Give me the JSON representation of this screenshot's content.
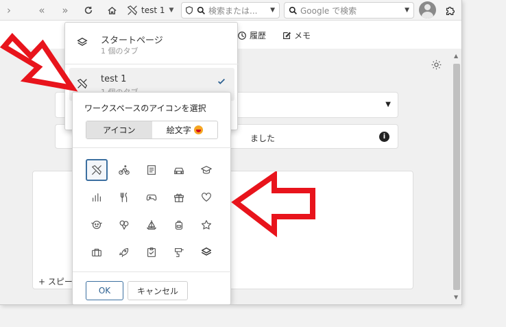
{
  "toolbar": {
    "workspace_name": "test 1",
    "url_placeholder": "検索または...",
    "search_placeholder": "Google で検索"
  },
  "bookmarks": {
    "history": "履歴",
    "memo": "メモ"
  },
  "workspace_menu": {
    "items": [
      {
        "name": "スタートページ",
        "count": "1 個のタブ"
      },
      {
        "name": "test 1",
        "count": "1 個のタブ",
        "active": true
      }
    ]
  },
  "content": {
    "notice_text": "ました",
    "speed_dial_add": "スピー"
  },
  "icon_picker": {
    "title": "ワークスペースのアイコンを選択",
    "tabs": [
      "アイコン",
      "絵文字"
    ],
    "selected_tab": "アイコン",
    "icons": [
      [
        "travel-icon",
        "bicycle-icon",
        "notes-icon",
        "car-icon",
        "graduation-cap-icon"
      ],
      [
        "bar-chart-icon",
        "utensils-icon",
        "gamepad-icon",
        "gift-icon",
        "heart-icon"
      ],
      [
        "face-icon",
        "balloons-icon",
        "sailboat-icon",
        "backpack-icon",
        "star-icon"
      ],
      [
        "briefcase-icon",
        "rocket-icon",
        "clipboard-icon",
        "drill-icon",
        "layers-icon"
      ]
    ],
    "selected_icon": "travel-icon",
    "ok_label": "OK",
    "cancel_label": "キャンセル"
  },
  "colors": {
    "accent": "#3b6fa0",
    "annotation_arrow": "#e8141c"
  }
}
